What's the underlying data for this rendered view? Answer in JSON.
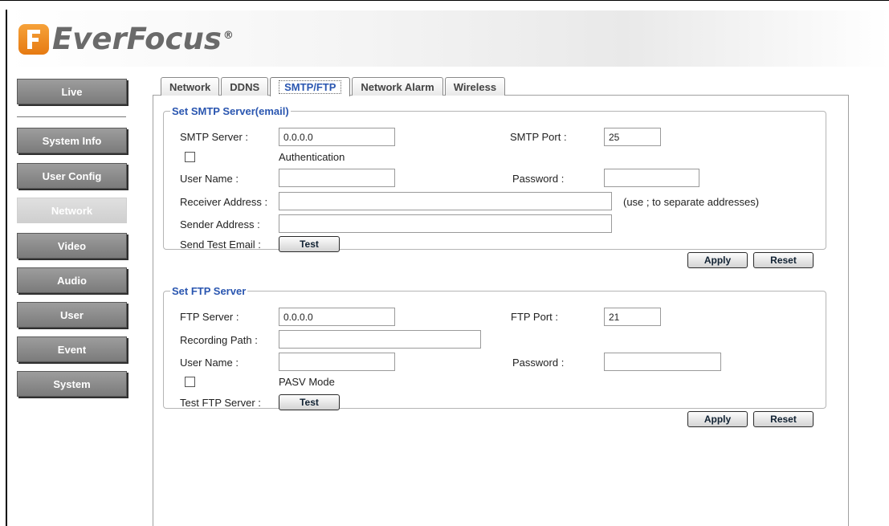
{
  "brand": {
    "name": "EverFocus",
    "mark": "®"
  },
  "sidebar": {
    "items": [
      {
        "label": "Live"
      },
      {
        "label": "System Info"
      },
      {
        "label": "User Config"
      },
      {
        "label": "Network",
        "active": true
      },
      {
        "label": "Video"
      },
      {
        "label": "Audio"
      },
      {
        "label": "User"
      },
      {
        "label": "Event"
      },
      {
        "label": "System"
      }
    ]
  },
  "tabs": [
    {
      "label": "Network"
    },
    {
      "label": "DDNS"
    },
    {
      "label": "SMTP/FTP",
      "active": true
    },
    {
      "label": "Network Alarm"
    },
    {
      "label": "Wireless"
    }
  ],
  "smtp": {
    "legend": "Set SMTP Server(email)",
    "server_label": "SMTP Server :",
    "server_value": "0.0.0.0",
    "port_label": "SMTP Port :",
    "port_value": "25",
    "auth_label": "Authentication",
    "auth_checked": false,
    "username_label": "User Name :",
    "username_value": "",
    "password_label": "Password :",
    "password_value": "",
    "receiver_label": "Receiver Address :",
    "receiver_value": "",
    "receiver_hint": "(use ; to separate addresses)",
    "sender_label": "Sender Address :",
    "sender_value": "",
    "test_label": "Send Test Email :",
    "test_button": "Test",
    "apply_button": "Apply",
    "reset_button": "Reset"
  },
  "ftp": {
    "legend": "Set FTP Server",
    "server_label": "FTP Server :",
    "server_value": "0.0.0.0",
    "port_label": "FTP Port :",
    "port_value": "21",
    "path_label": "Recording Path :",
    "path_value": "",
    "username_label": "User Name :",
    "username_value": "",
    "password_label": "Password :",
    "password_value": "",
    "pasv_label": "PASV Mode",
    "pasv_checked": false,
    "test_label": "Test FTP Server :",
    "test_button": "Test",
    "apply_button": "Apply",
    "reset_button": "Reset"
  },
  "colors": {
    "accent": "#2a56b0",
    "nav_button": "#8c8c8c",
    "nav_active": "#d8d8d8",
    "logo_orange": "#ef8a1f"
  }
}
